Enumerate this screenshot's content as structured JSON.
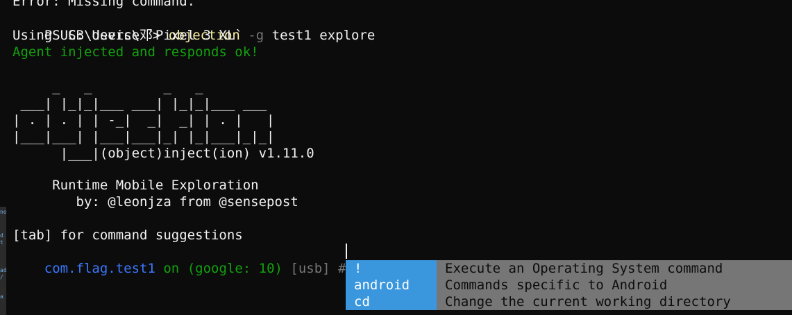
{
  "history": {
    "error_line": "Error: Missing command.",
    "prompt": "PS C:\\Users\\邓> ",
    "command": "objection",
    "flag": " -g",
    "args": " test1 explore",
    "device_line": "Using USB device `Pixel 3 XL`",
    "agent_line": "Agent injected and responds ok!"
  },
  "banner": {
    "art": "     _   _         _   _\n ___| |_|_|___ ___| |_|_|___ ___\n| . | . | | -_|  _|  _| | . |   |\n|___|___| |___|___|_| |_|___|_|_|\n      |___|(object)inject(ion) v1.11.0",
    "tagline": "     Runtime Mobile Exploration",
    "credits": "        by: @leonjza from @sensepost"
  },
  "hint": "[tab] for command suggestions",
  "current_prompt": {
    "package": "com.flag.test1",
    "on": " on ",
    "device": "(google: 10)",
    "transport": " [usb] #"
  },
  "completion": {
    "items": [
      {
        "command": "!",
        "description": "Execute an Operating System command"
      },
      {
        "command": "android",
        "description": "Commands specific to Android"
      },
      {
        "command": "cd",
        "description": "Change the current working directory"
      }
    ]
  },
  "left_strip": [
    "no",
    "",
    "d",
    "t",
    "",
    "ad",
    "/",
    "",
    "a"
  ],
  "colors": {
    "background": "#0c0c0c",
    "foreground": "#f2f2f2",
    "green": "#13a10e",
    "yellow": "#f9f1a5",
    "blue": "#3b78ff",
    "gray": "#767676",
    "completion_selected": "#3a96dd",
    "completion_desc_bg": "#767676"
  }
}
